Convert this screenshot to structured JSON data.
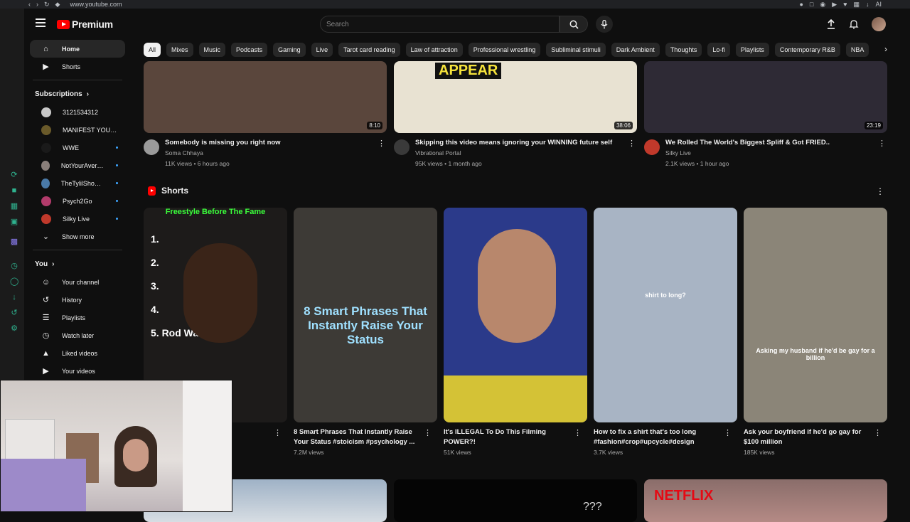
{
  "browser": {
    "url": "www.youtube.com",
    "profile_label": "AI"
  },
  "masthead": {
    "brand": "Premium",
    "search_placeholder": "Search"
  },
  "sidebar": {
    "main": [
      {
        "label": "Home",
        "icon": "home-icon"
      },
      {
        "label": "Shorts",
        "icon": "shorts-icon"
      }
    ],
    "subscriptions_title": "Subscriptions",
    "subscriptions": [
      {
        "label": "3121534312",
        "color": "#c9c9c9",
        "dot": false
      },
      {
        "label": "MANIFEST YOURS...",
        "color": "#6a5a2a",
        "dot": false
      },
      {
        "label": "WWE",
        "color": "#1a1a1a",
        "dot": true
      },
      {
        "label": "NotYourAverage...",
        "color": "#8a7f7a",
        "dot": true
      },
      {
        "label": "TheTylilShow Live",
        "color": "#4a7aa8",
        "dot": true
      },
      {
        "label": "Psych2Go",
        "color": "#b23b6b",
        "dot": true
      },
      {
        "label": "Silky Live",
        "color": "#c0392b",
        "dot": true
      }
    ],
    "show_more": "Show more",
    "you_title": "You",
    "you_items": [
      {
        "label": "Your channel",
        "icon": "channel-icon"
      },
      {
        "label": "History",
        "icon": "history-icon"
      },
      {
        "label": "Playlists",
        "icon": "playlists-icon"
      },
      {
        "label": "Watch later",
        "icon": "watch-later-icon"
      },
      {
        "label": "Liked videos",
        "icon": "liked-icon"
      },
      {
        "label": "Your videos",
        "icon": "your-videos-icon"
      }
    ]
  },
  "chips": [
    "All",
    "Mixes",
    "Music",
    "Podcasts",
    "Gaming",
    "Live",
    "Tarot card reading",
    "Law of attraction",
    "Professional wrestling",
    "Subliminal stimuli",
    "Dark Ambient",
    "Thoughts",
    "Lo-fi",
    "Playlists",
    "Contemporary R&B",
    "NBA"
  ],
  "videos": [
    {
      "title": "Somebody is missing you right now",
      "channel": "Soma Chhaya",
      "meta": "11K views • 6 hours ago",
      "duration": "8:10",
      "thumb_color": "#5a463c",
      "avatar_color": "#9a9a9a"
    },
    {
      "title": "Skipping this video means ignoring your WINNING future self",
      "channel": "Vibrational Portal",
      "meta": "95K views • 1 month ago",
      "duration": "38:06",
      "thumb_color": "#e8e2d2",
      "avatar_color": "#3a3a3a",
      "overlay": "APPEAR"
    },
    {
      "title": "We Rolled The World's Biggest Spliff & Got FRIED..",
      "channel": "Silky Live",
      "meta": "2.1K views • 1 hour ago",
      "duration": "23:19",
      "thumb_color": "#2e2a35",
      "avatar_color": "#c0392b"
    }
  ],
  "shorts_title": "Shorts",
  "shorts": [
    {
      "title": "Freestyle Before The Fame",
      "views": "",
      "overlay_top": "Freestyle Before The Fame",
      "list": [
        "1.",
        "2.",
        "3.",
        "4.",
        "5. Rod Wave"
      ],
      "thumb_color": "#1d1b1a"
    },
    {
      "title": "8 Smart Phrases That Instantly Raise Your Status #stoicism #psychology ...",
      "views": "7.2M views",
      "overlay": "8 Smart Phrases That Instantly Raise Your Status",
      "thumb_color": "#3d3a36"
    },
    {
      "title": "It's ILLEGAL To Do This Filming POWER?!",
      "views": "51K views",
      "thumb_color": "#2b3a8a"
    },
    {
      "title": "How to fix a shirt that's too long #fashion#crop#upcycle#design",
      "views": "3.7K views",
      "overlay": "shirt to long?",
      "thumb_color": "#a8b4c4"
    },
    {
      "title": "Ask your boyfriend if he'd go gay for $100 million",
      "views": "185K views",
      "overlay": "Asking my husband if he'd be gay for a billion",
      "thumb_color": "#8b8578"
    }
  ],
  "shorts_first_title_visible": "E FAME",
  "bottom_row": [
    "???",
    "NETFLIX"
  ]
}
